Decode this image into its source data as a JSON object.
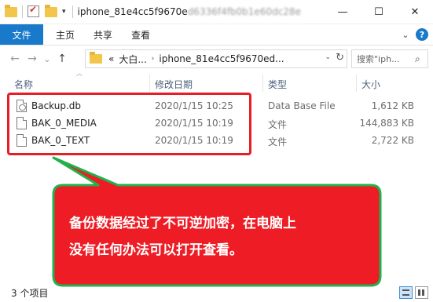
{
  "window": {
    "title_visible": "iphone_81e4cc5f9670e",
    "title_blurred": "d6336f4fb0b1e60dc28e",
    "minimize": "—",
    "maximize": "☐",
    "close": "✕"
  },
  "ribbon": {
    "file": "文件",
    "tabs": [
      "主页",
      "共享",
      "查看"
    ],
    "expand_icon": "chevron-down-icon",
    "help": "?"
  },
  "nav": {
    "back": "←",
    "forward": "→",
    "recent": "⌄",
    "up": "↑",
    "address": {
      "prefix": "«",
      "segments": [
        "大白...",
        "iphone_81e4cc5f9670ed..."
      ],
      "separator": "›",
      "dropdown": "⌄",
      "refresh": "↻"
    },
    "search_placeholder": "搜索\"iph...",
    "search_icon": "⌕"
  },
  "columns": {
    "name": "名称",
    "date": "修改日期",
    "type": "类型",
    "size": "大小"
  },
  "files": [
    {
      "name": "Backup.db",
      "date": "2020/1/15 10:25",
      "type": "Data Base File",
      "size": "1,612 KB",
      "icon": "database-file-icon"
    },
    {
      "name": "BAK_0_MEDIA",
      "date": "2020/1/15 10:19",
      "type": "文件",
      "size": "144,883 KB",
      "icon": "file-icon"
    },
    {
      "name": "BAK_0_TEXT",
      "date": "2020/1/15 10:19",
      "type": "文件",
      "size": "2,722 KB",
      "icon": "file-icon"
    }
  ],
  "callout": {
    "line1": "备份数据经过了不可逆加密，在电脑上",
    "line2": "没有任何办法可以打开查看。",
    "fill": "#ee1c25",
    "stroke": "#22b14c"
  },
  "status": {
    "count": "3 个项目"
  },
  "colors": {
    "accent": "#1979ca",
    "highlight": "#e61e26"
  }
}
